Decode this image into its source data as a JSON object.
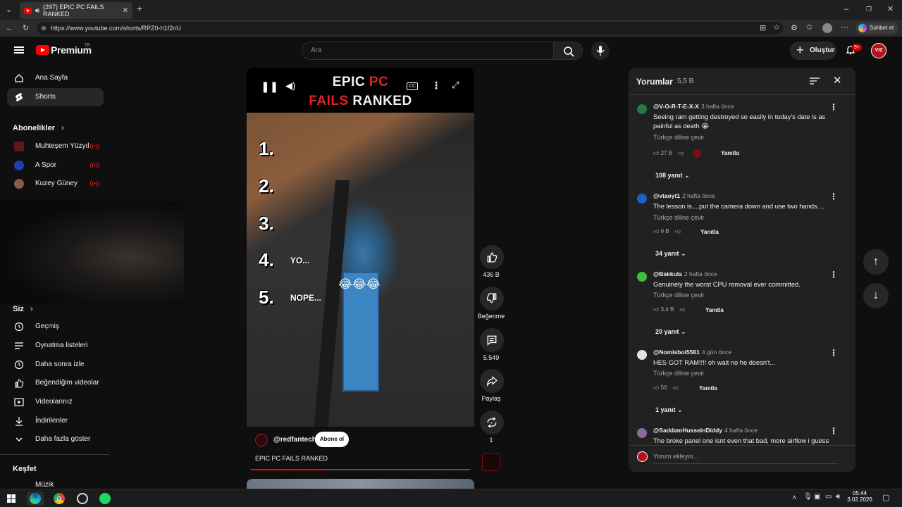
{
  "browser": {
    "tab_title": "(297) EPIC PC FAILS RANKED",
    "url": "https://www.youtube.com/shorts/RPZ0-h1f2nU",
    "copilot_label": "Sohbet et"
  },
  "header": {
    "logo_text": "Premium",
    "country": "TR",
    "search_placeholder": "Ara",
    "create_label": "Oluştur",
    "notif_count": "9+",
    "avatar_text": "VIZ"
  },
  "sidebar": {
    "home": "Ana Sayfa",
    "shorts": "Shorts",
    "subs_header": "Abonelikler",
    "subs": [
      {
        "name": "Muhteşem Yüzyıl",
        "color": "#5a1a1a"
      },
      {
        "name": "A Spor",
        "color": "#1f3fb0"
      },
      {
        "name": "Kuzey Güney",
        "color": "#8a5a4a"
      }
    ],
    "you_header": "Siz",
    "you_items": [
      "Geçmiş",
      "Oynatma listeleri",
      "Daha sonra izle",
      "Beğendiğim videolar",
      "Videolarınız",
      "İndirilenler",
      "Daha fazla göster"
    ],
    "explore_header": "Keşfet",
    "explore_first": "Müzik"
  },
  "video": {
    "title_line1_white": "EPIC",
    "title_line1_red": "PC",
    "title_line2_red": "FAILS",
    "title_line2_white": "RANKED",
    "ranks": [
      "1.",
      "2.",
      "3.",
      "4.",
      "5."
    ],
    "rank4_note": "YO...",
    "rank5_note": "NOPE...",
    "emojis": "😂😂😂",
    "channel": "@redfantech",
    "subscribe": "Abone ol",
    "caption": "EPIC PC FAILS RANKED",
    "progress": 0.34
  },
  "actions": {
    "likes": "436 B",
    "dislike": "Beğenme",
    "comments": "5.549",
    "share": "Paylaş",
    "remix": "1"
  },
  "comments": {
    "title": "Yorumlar",
    "count": "5,5 B",
    "translate": "Türkçe diline çevir",
    "reply": "Yanıtla",
    "add_placeholder": "Yorum ekleyin...",
    "items": [
      {
        "author": "@V-O-R-T-E-X-X",
        "time": "3 hafta önce",
        "text": "Seeing ram getting destroyed so easily in today's date is as painful as death 😭",
        "likes": "27 B",
        "replies": "108 yanıt",
        "avatar": "#2a7a3a"
      },
      {
        "author": "@vtaoyt1",
        "time": "2 hafta önce",
        "text": "The lesson is....put the camera down and use two hands....",
        "likes": "9 B",
        "replies": "34 yanıt",
        "avatar": "#1f5fbf"
      },
      {
        "author": "@Bakkula",
        "time": "2 hafta önce",
        "text": "Genuinely the worst CPU removal ever committed.",
        "likes": "3,4 B",
        "replies": "20 yanıt",
        "avatar": "#3ac03a"
      },
      {
        "author": "@Nomisboi5561",
        "time": "4 gün önce",
        "text": "HES GOT RAM!!!! oh wait no he doesn't...",
        "likes": "50",
        "replies": "1 yanıt",
        "avatar": "#e8e0d8"
      },
      {
        "author": "@SaddamHusseinDiddy",
        "time": "4 hafta önce",
        "text": "The broke panel one isnt even that bad, more airflow i guess",
        "likes": "",
        "replies": "",
        "avatar": "#8a6aa0"
      }
    ]
  },
  "taskbar": {
    "time": "05:44",
    "date": "3.02.2026"
  }
}
